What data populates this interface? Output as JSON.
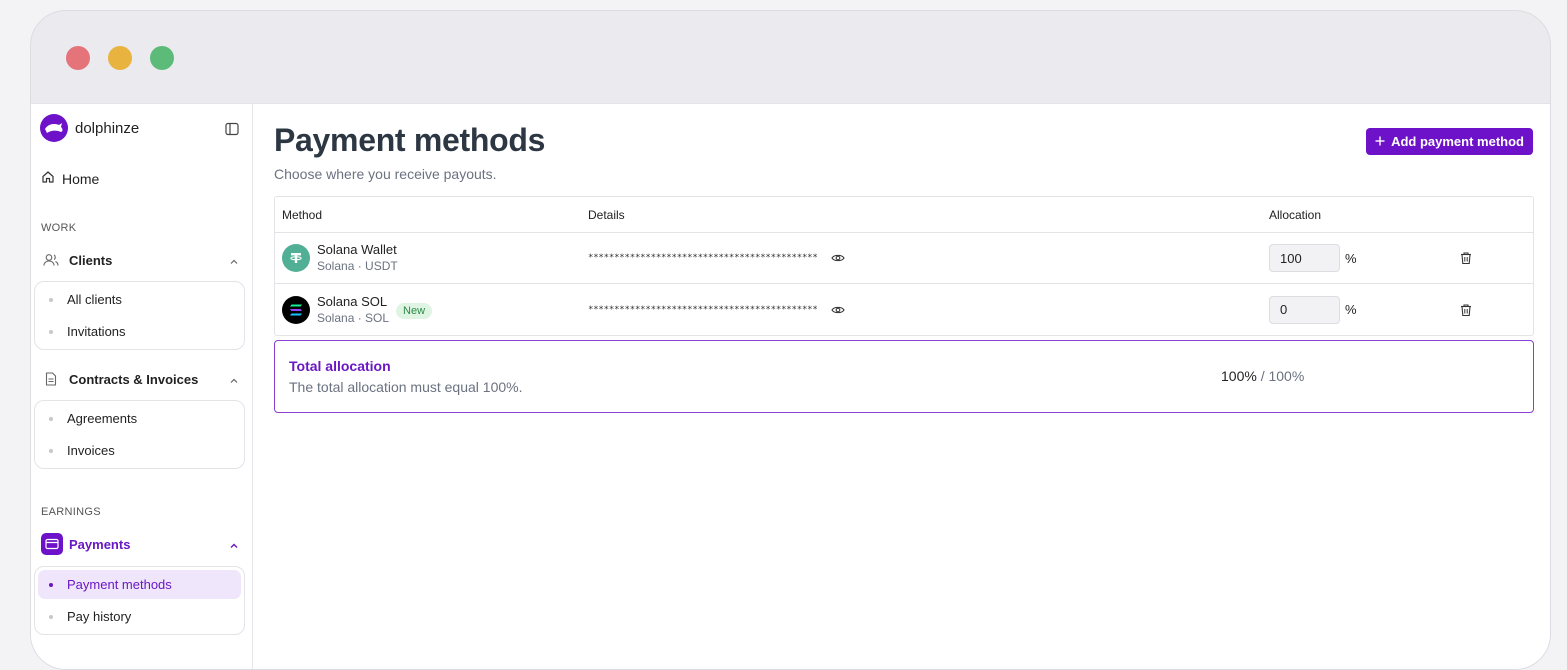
{
  "brand": {
    "name": "dolphinze"
  },
  "nav": {
    "home": "Home",
    "work_label": "WORK",
    "clients": {
      "label": "Clients",
      "items": [
        "All clients",
        "Invitations"
      ]
    },
    "contracts": {
      "label": "Contracts & Invoices",
      "items": [
        "Agreements",
        "Invoices"
      ]
    },
    "earnings_label": "EARNINGS",
    "payments": {
      "label": "Payments",
      "items": [
        "Payment methods",
        "Pay history"
      ],
      "active": "Payment methods"
    }
  },
  "page": {
    "title": "Payment methods",
    "subtitle": "Choose where you receive payouts.",
    "add_button": "Add payment method"
  },
  "table": {
    "headers": {
      "method": "Method",
      "details": "Details",
      "allocation": "Allocation"
    },
    "rows": [
      {
        "name": "Solana Wallet",
        "sub": "Solana · USDT",
        "badge": "",
        "masked": "********************************************",
        "allocation": "100",
        "unit": "%",
        "icon": "tether-icon",
        "icon_color": "#50af95"
      },
      {
        "name": "Solana SOL",
        "sub": "Solana · SOL",
        "badge": "New",
        "masked": "********************************************",
        "allocation": "0",
        "unit": "%",
        "icon": "solana-icon",
        "icon_color": "#000000"
      }
    ]
  },
  "total": {
    "title": "Total allocation",
    "description": "The total allocation must equal 100%.",
    "current": "100%",
    "target": "/ 100%"
  },
  "colors": {
    "accent": "#6d12c9",
    "active_bg": "#efe6fb"
  }
}
